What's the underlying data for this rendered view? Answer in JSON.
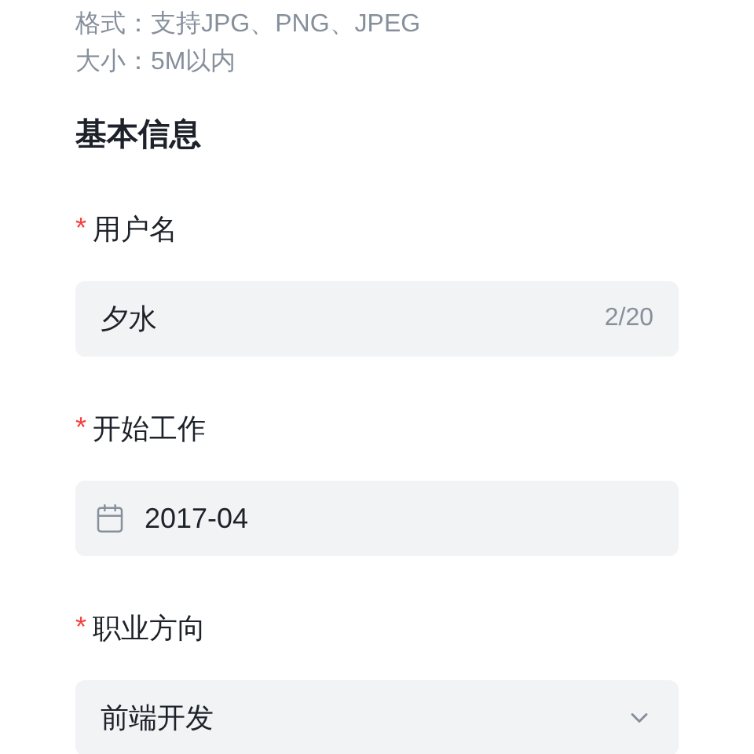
{
  "hints": [
    "格式：支持JPG、PNG、JPEG",
    "大小：5M以内"
  ],
  "section_title": "基本信息",
  "fields": [
    {
      "kind": "text",
      "required_mark": "*",
      "label": "用户名",
      "value": "夕水",
      "counter": "2/20"
    },
    {
      "kind": "date",
      "required_mark": "*",
      "label": "开始工作",
      "value": "2017-04"
    },
    {
      "kind": "select",
      "required_mark": "*",
      "label": "职业方向",
      "value": "前端开发"
    }
  ]
}
